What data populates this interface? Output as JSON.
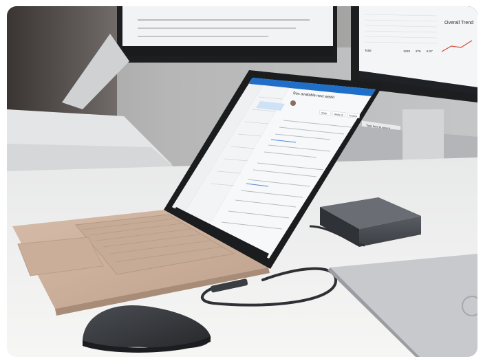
{
  "photo": {
    "subject_colors": {
      "laptop_body": "#cdb3a0",
      "desk": "#f1f1f0",
      "dock": "#4a4d52",
      "mouse": "#3a3c40",
      "accent_blue": "#1f6fc9"
    }
  },
  "laptop_screen": {
    "email_subject": "Box available next week!",
    "reply_buttons": [
      "Reply",
      "Reply all",
      "Forward"
    ]
  },
  "right_monitor": {
    "chart_title": "Overall Trend",
    "table_total_label": "Total",
    "table_total_values": [
      "1029",
      "276",
      "8.27"
    ],
    "search_placeholder": "Type here to search"
  }
}
